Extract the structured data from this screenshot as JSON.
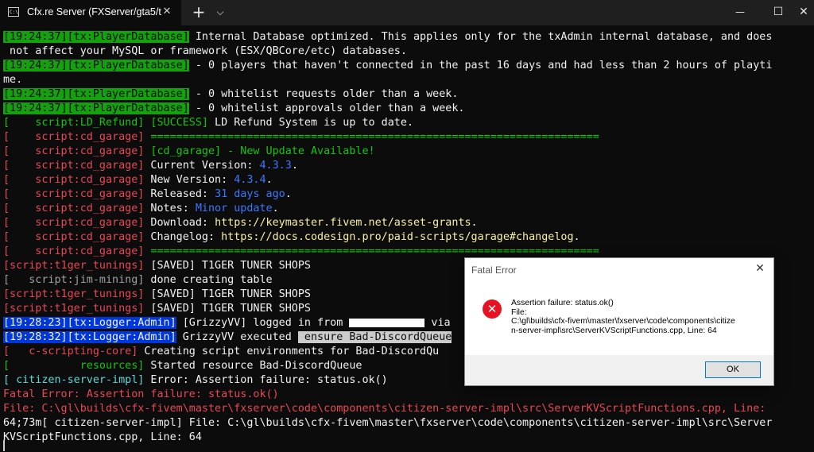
{
  "window": {
    "tab_title": "Cfx.re Server (FXServer/gta5/t",
    "tab_icon_text": "C:\\",
    "close_glyph": "✕",
    "new_tab_glyph": "+",
    "dropdown_glyph": "⌵",
    "minimize_glyph": "—",
    "maximize_glyph": "☐",
    "window_close_glyph": "✕"
  },
  "console": {
    "l1": {
      "tag": "[19:24:37][tx:PlayerDatabase]",
      "text": " Internal Database optimized. This applies only for the txAdmin internal database, and does"
    },
    "l2": {
      "text": " not affect your MySQL or framework (ESX/QBCore/etc) databases."
    },
    "l3": {
      "tag": "[19:24:37][tx:PlayerDatabase]",
      "text": " - 0 players that haven't connected in the past 16 days and had less than 2 hours of playti"
    },
    "l4": {
      "text": "me."
    },
    "l5": {
      "tag": "[19:24:37][tx:PlayerDatabase]",
      "text": " - 0 whitelist requests older than a week."
    },
    "l6": {
      "tag": "[19:24:37][tx:PlayerDatabase]",
      "text": " - 0 whitelist approvals older than a week."
    },
    "l7": {
      "tag": "[    script:LD_Refund]",
      "success": " [SUCCESS]",
      "text": " LD Refund System is up to date."
    },
    "l8": {
      "tag": "[    script:cd_garage]",
      "text": " ======================================================================"
    },
    "l9": {
      "tag": "[    script:cd_garage]",
      "text": " [cd_garage] - New Update Available!"
    },
    "l10": {
      "tag": "[    script:cd_garage]",
      "label": " Current Version: ",
      "value": "4.3.3",
      "end": "."
    },
    "l11": {
      "tag": "[    script:cd_garage]",
      "label": " New Version: ",
      "value": "4.3.4",
      "end": "."
    },
    "l12": {
      "tag": "[    script:cd_garage]",
      "label": " Released: ",
      "value": "31 days ago",
      "end": "."
    },
    "l13": {
      "tag": "[    script:cd_garage]",
      "label": " Notes: ",
      "value": "Minor update",
      "end": "."
    },
    "l14": {
      "tag": "[    script:cd_garage]",
      "label": " Download: ",
      "value": "https://keymaster.fivem.net/asset-grants",
      "end": "."
    },
    "l15": {
      "tag": "[    script:cd_garage]",
      "label": " Changelog: ",
      "value": "https://docs.codesign.pro/paid-scripts/garage#changelog",
      "end": "."
    },
    "l16": {
      "tag": "[    script:cd_garage]",
      "text": " ======================================================================"
    },
    "l17": {
      "tag": "[script:t1ger_tunings]",
      "text": " [SAVED] T1GER TUNER SHOPS"
    },
    "l18": {
      "tag": "[   script:jim-mining]",
      "text": " done creating table"
    },
    "l19": {
      "tag": "[script:t1ger_tunings]",
      "text": " [SAVED] T1GER TUNER SHOPS"
    },
    "l20": {
      "tag": "[script:t1ger_tunings]",
      "text": " [SAVED] T1GER TUNER SHOPS"
    },
    "l21": {
      "tag": "[19:28:23][tx:Logger:Admin]",
      "text": " [GrizzyVV] logged in from ",
      "end": " via"
    },
    "l22": {
      "tag": "[19:28:32][tx:Logger:Admin]",
      "text": " GrizzyVV executed ",
      "cmd": " ensure Bad-DiscordQueue"
    },
    "l23": {
      "tag": "[   c-scripting-core]",
      "text": " Creating script environments for Bad-DiscordQu"
    },
    "l24": {
      "tag": "[           resources]",
      "text": " Started resource Bad-DiscordQueue"
    },
    "l25": {
      "tag": "[ citizen-server-impl]",
      "text": " Error: Assertion failure: status.ok()"
    },
    "l26": {
      "text": "Fatal Error: Assertion failure: status.ok()"
    },
    "l27": {
      "text": "File: C:\\gl\\builds\\cfx-fivem\\master\\fxserver\\code\\components\\citizen-server-impl\\src\\ServerKVScriptFunctions.cpp, Line:"
    },
    "l28": {
      "text": "64;73m[ citizen-server-impl] File: C:\\gl\\builds\\cfx-fivem\\master\\fxserver\\code\\components\\citizen-server-impl\\src\\Server"
    },
    "l29": {
      "text": "KVScriptFunctions.cpp, Line: 64"
    }
  },
  "dialog": {
    "title": "Fatal Error",
    "close_glyph": "✕",
    "icon_glyph": "✕",
    "line1": "Assertion failure: status.ok()",
    "line2": "File:",
    "line3": "C:\\gl\\builds\\cfx-fivem\\master\\fxserver\\code\\components\\citize",
    "line4": "n-server-impl\\src\\ServerKVScriptFunctions.cpp, Line: 64",
    "ok_label": "OK"
  },
  "colors": {
    "background": "#0c0c0c",
    "green": "#16c60c",
    "red": "#e74856",
    "blue_bg": "#0037da",
    "error_icon": "#e81123"
  }
}
